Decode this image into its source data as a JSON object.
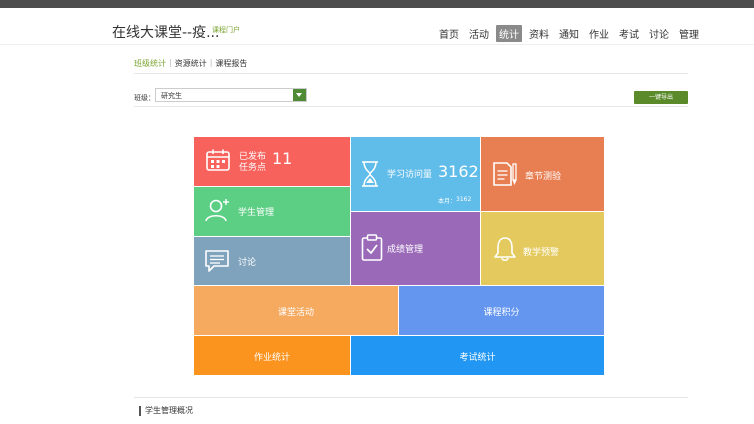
{
  "header": {
    "course_title": "在线大课堂--疫...",
    "portal_link": "课程门户",
    "nav": [
      "首页",
      "活动",
      "统计",
      "资料",
      "通知",
      "作业",
      "考试",
      "讨论",
      "管理"
    ],
    "active_nav": "统计"
  },
  "subtabs": [
    "班级统计",
    "资源统计",
    "课程报告"
  ],
  "filter": {
    "class_label": "班级：",
    "class_value": "研究生",
    "export_label": "一键导出"
  },
  "tiles": {
    "tasks": {
      "label_line1": "已发布",
      "label_line2": "任务点",
      "count": "11",
      "color": "#f7625d",
      "icon": "calendar-icon"
    },
    "students": {
      "label": "学生管理",
      "color": "#5ccf85",
      "icon": "user-add-icon"
    },
    "discussion": {
      "label": "讨论",
      "color": "#7fa2bd",
      "icon": "chat-icon"
    },
    "visits": {
      "label": "学习访问量",
      "count": "3162",
      "month_label": "本月：",
      "month_count": "3162",
      "color": "#60bce9",
      "icon": "hourglass-icon"
    },
    "grades": {
      "label": "成绩管理",
      "color": "#9a6ab8",
      "icon": "clipboard-check-icon"
    },
    "quiz": {
      "label": "章节测验",
      "color": "#e87f53",
      "icon": "document-pen-icon"
    },
    "warning": {
      "label": "教学预警",
      "color": "#e4ca5e",
      "icon": "bell-icon"
    },
    "class_activity": {
      "label": "课堂活动",
      "color": "#f5aa60"
    },
    "points": {
      "label": "课程积分",
      "color": "#6496ef"
    },
    "homework": {
      "label": "作业统计",
      "color": "#fb931f"
    },
    "exam": {
      "label": "考试统计",
      "color": "#2197f3"
    }
  },
  "bottom": {
    "heading": "学生管理概况"
  },
  "colors": {
    "accent": "#7aa32e",
    "export_button": "#5a8a2a"
  }
}
